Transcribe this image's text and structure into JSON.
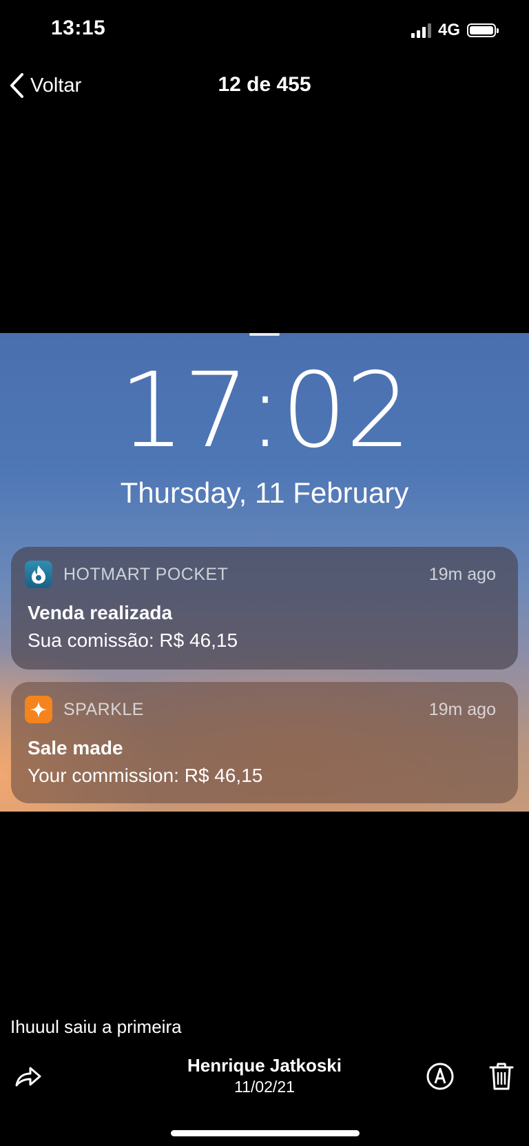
{
  "status_bar": {
    "time": "13:15",
    "network": "4G"
  },
  "nav": {
    "back_label": "Voltar",
    "title": "12 de 455"
  },
  "photo": {
    "lock_time": "17:02",
    "lock_date": "Thursday, 11 February",
    "notifications": [
      {
        "app": "HOTMART POCKET",
        "time": "19m ago",
        "title": "Venda realizada",
        "body": "Sua comissão: R$ 46,15",
        "icon": "hotmart-icon"
      },
      {
        "app": "SPARKLE",
        "time": "19m ago",
        "title": "Sale made",
        "body": "Your commission: R$ 46,15",
        "icon": "sparkle-icon"
      }
    ]
  },
  "footer": {
    "caption": "Ihuuul saiu a primeira",
    "sender": "Henrique Jatkoski",
    "date": "11/02/21"
  }
}
